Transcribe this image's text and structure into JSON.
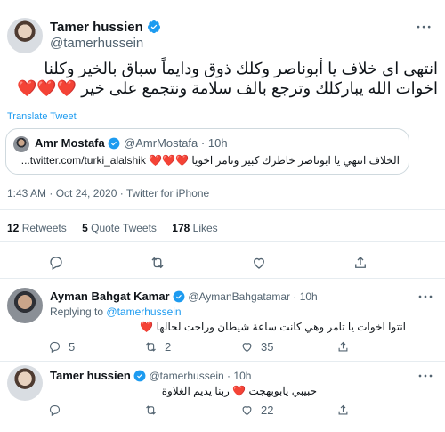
{
  "main_tweet": {
    "author_name": "Tamer hussien",
    "handle": "@tamerhussein",
    "text": "انتهى اى خلاف يا أبوناصر وكلك ذوق ودايماً سباق بالخير وكلنا اخوات الله يباركلك وترجع بالف سلامة ونتجمع على خير",
    "hearts": "❤️❤️❤️",
    "translate": "Translate Tweet",
    "timestamp": "1:43 AM · Oct 24, 2020 · Twitter for iPhone",
    "stats": {
      "retweets_count": "12",
      "retweets_label": "Retweets",
      "quotes_count": "5",
      "quotes_label": "Quote Tweets",
      "likes_count": "178",
      "likes_label": "Likes"
    }
  },
  "quoted_tweet": {
    "author_name": "Amr Mostafa",
    "handle": "@AmrMostafa",
    "time": "10h",
    "text": "الخلاف انتهي يا ابوناصر  خاطرك كبير وتامر اخويا ❤️❤️❤️ twitter.com/turki_alalshik..."
  },
  "replies": [
    {
      "author_name": "Ayman Bahgat Kamar",
      "handle": "@AymanBahgatamar",
      "time": "10h",
      "replying_prefix": "Replying to",
      "replying_to": "@tamerhussein",
      "text": "انتوا اخوات يا تامر وهي كانت ساعة شيطان وراحت لحالها ❤️",
      "reply_count": "5",
      "retweet_count": "2",
      "like_count": "35"
    },
    {
      "author_name": "Tamer hussien",
      "handle": "@tamerhussein",
      "time": "10h",
      "text": "حبيبي يابوبهجت ❤️ ربنا يديم الغلاوة",
      "reply_count": "",
      "retweet_count": "",
      "like_count": "22"
    }
  ],
  "sep": "·",
  "colors": {
    "accent": "#1d9bf0",
    "heart": "#e0245e",
    "muted": "#536471",
    "border": "#e6ecf0"
  }
}
